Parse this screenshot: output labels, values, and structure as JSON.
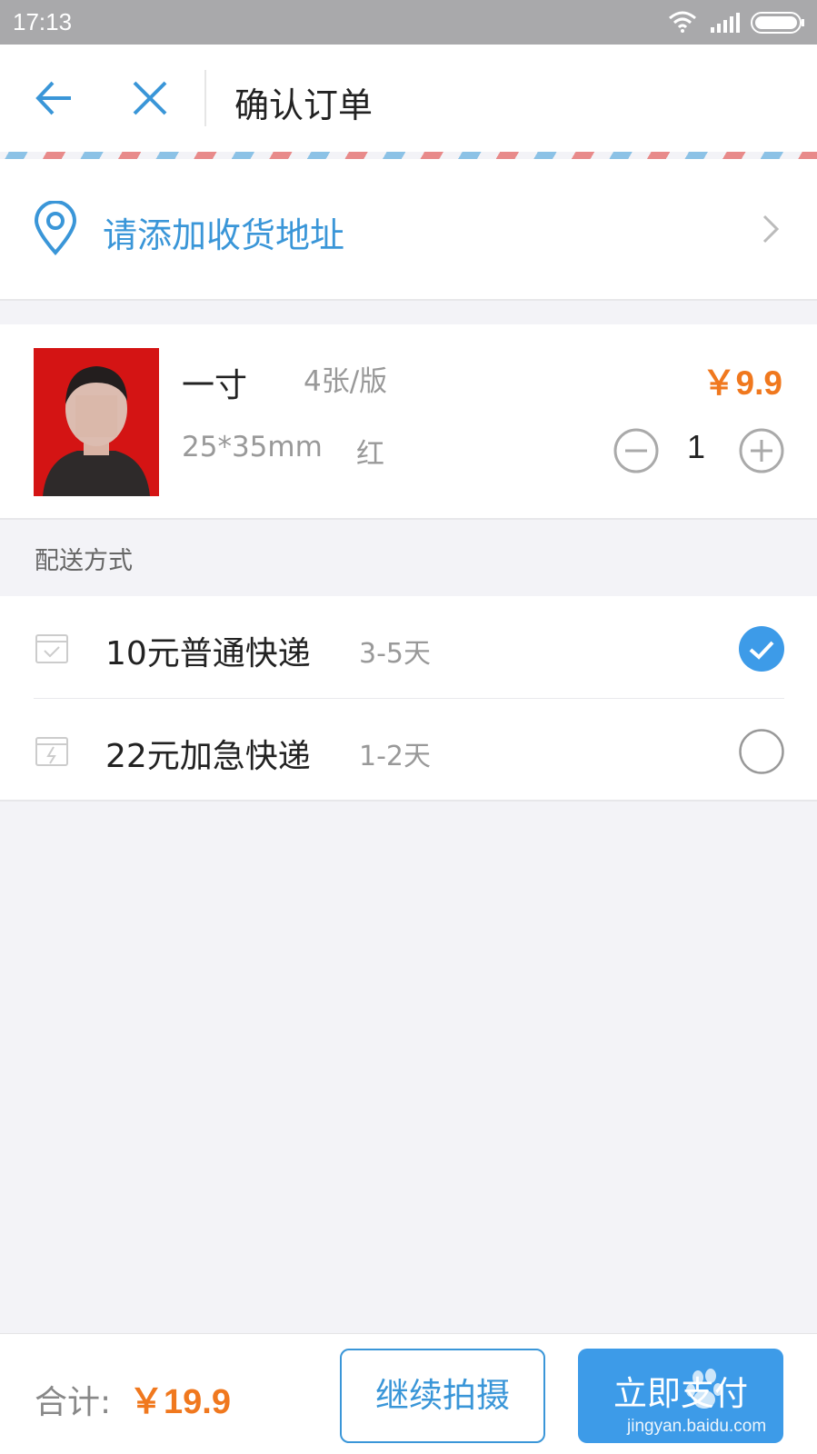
{
  "status_bar": {
    "time": "17:13"
  },
  "header": {
    "title": "确认订单"
  },
  "address": {
    "prompt": "请添加收货地址"
  },
  "product": {
    "name": "一寸",
    "spec": "4张/版",
    "size": "25*35mm",
    "background_color": "红",
    "price": "￥9.9",
    "quantity": "1"
  },
  "shipping": {
    "label": "配送方式",
    "options": [
      {
        "name": "10元普通快递",
        "days": "3-5天",
        "selected": true
      },
      {
        "name": "22元加急快递",
        "days": "1-2天",
        "selected": false
      }
    ]
  },
  "footer": {
    "total_label": "合计:",
    "total_value": "￥19.9",
    "continue_label": "继续拍摄",
    "pay_label": "立即支付"
  },
  "watermark": {
    "text": "jingyan.baidu.com"
  },
  "colors": {
    "accent_blue": "#3a96d8",
    "price_orange": "#f0781e",
    "photo_background": "#d41414"
  },
  "icons": [
    "back-arrow-icon",
    "close-icon",
    "location-pin-icon",
    "chevron-right-icon",
    "minus-circle-icon",
    "plus-circle-icon",
    "package-check-icon",
    "package-bolt-icon",
    "checked-radio-icon",
    "radio-icon"
  ]
}
